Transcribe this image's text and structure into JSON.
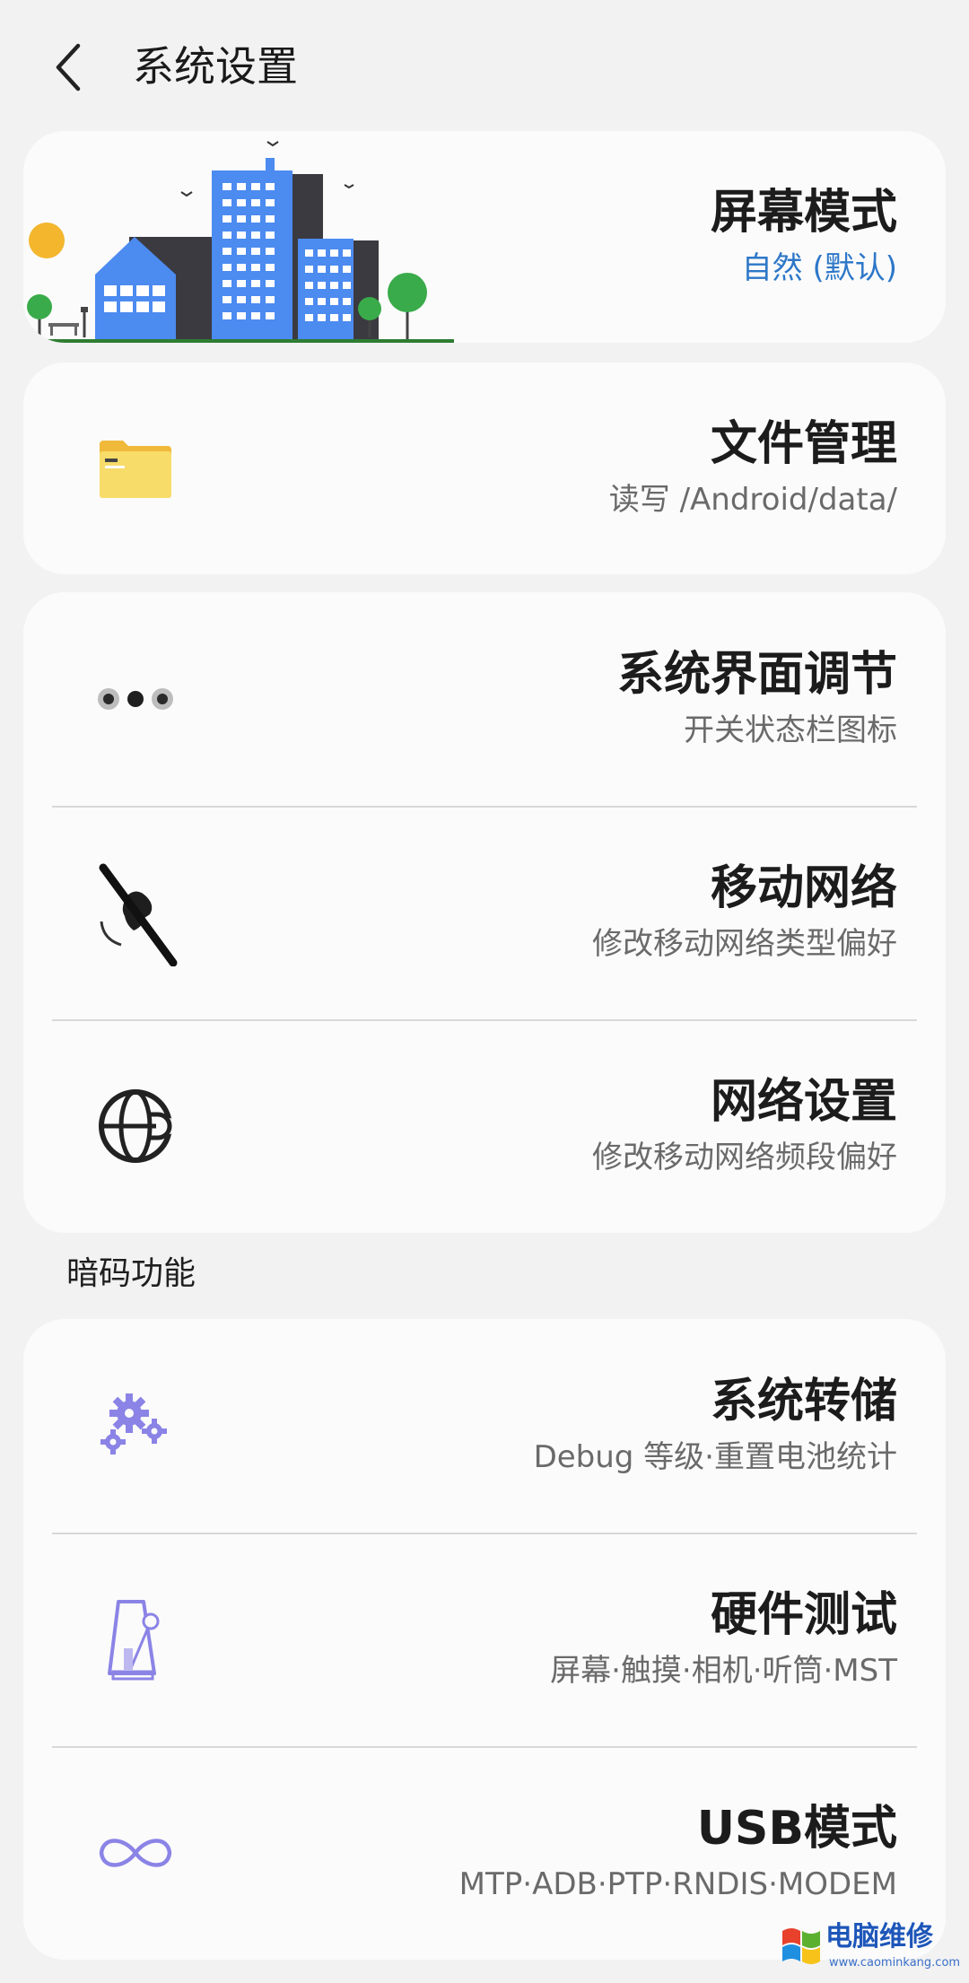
{
  "header": {
    "title": "系统设置"
  },
  "cards": {
    "screen": {
      "title": "屏幕模式",
      "subtitle": "自然 (默认)"
    },
    "files": {
      "title": "文件管理",
      "subtitle": "读写 /Android/data/"
    },
    "system": [
      {
        "title": "系统界面调节",
        "subtitle": "开关状态栏图标",
        "icon": "dots-icon"
      },
      {
        "title": "移动网络",
        "subtitle": "修改移动网络类型偏好",
        "icon": "satellite-off-icon"
      },
      {
        "title": "网络设置",
        "subtitle": "修改移动网络频段偏好",
        "icon": "globe-icon"
      }
    ]
  },
  "section": {
    "label": "暗码功能"
  },
  "codes": [
    {
      "title": "系统转储",
      "subtitle": "Debug 等级·重置电池统计",
      "icon": "gears-icon"
    },
    {
      "title": "硬件测试",
      "subtitle": "屏幕·触摸·相机·听筒·MST",
      "icon": "metronome-icon"
    },
    {
      "title": "USB模式",
      "subtitle": "MTP·ADB·PTP·RNDIS·MODEM",
      "icon": "infinity-icon"
    }
  ],
  "watermark": {
    "text": "电脑维修",
    "url": "www.caominkang.com"
  },
  "colors": {
    "background": "#f2f2f2",
    "card": "#fbfbfb",
    "accent": "#2d77c8",
    "icon_purple": "#8b84e6",
    "folder": "#f5cf4a"
  }
}
